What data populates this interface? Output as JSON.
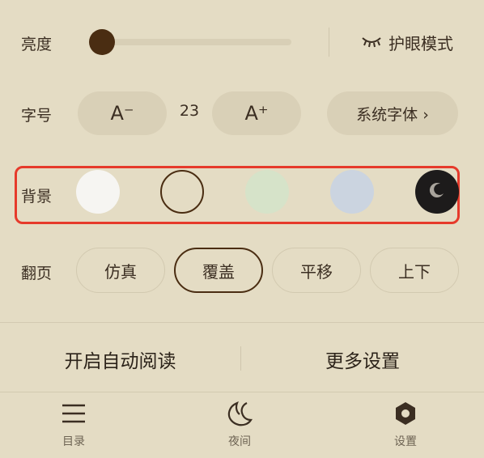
{
  "brightness": {
    "label": "亮度",
    "level": 0.0
  },
  "eye_mode": {
    "label": "护眼模式",
    "icon": "closed-eye-icon"
  },
  "font_size": {
    "label": "字号",
    "decrease": "A⁻",
    "value": "23",
    "increase": "A⁺"
  },
  "font_face": {
    "label": "系统字体 ›"
  },
  "background": {
    "label": "背景",
    "colors": [
      "#f6f5f2",
      "#e4dcc4",
      "#d6e3c9",
      "#cbd4e0",
      "#1d1b1b"
    ],
    "selected_index": 1,
    "night_icon": "moon-icon"
  },
  "page_turn": {
    "label": "翻页",
    "options": [
      "仿真",
      "覆盖",
      "平移",
      "上下"
    ],
    "selected_index": 1
  },
  "actions": {
    "auto_read": "开启自动阅读",
    "more_settings": "更多设置"
  },
  "bottom_nav": [
    {
      "label": "目录",
      "icon": "menu-icon"
    },
    {
      "label": "夜间",
      "icon": "moon-outline-icon"
    },
    {
      "label": "设置",
      "icon": "gear-icon"
    }
  ]
}
